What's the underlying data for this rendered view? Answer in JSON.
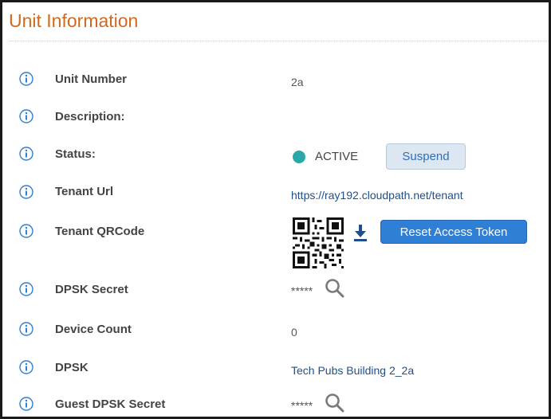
{
  "panel": {
    "title": "Unit Information"
  },
  "rows": {
    "unit_number": {
      "label": "Unit Number",
      "value": "2a"
    },
    "description": {
      "label": "Description:",
      "value": ""
    },
    "status": {
      "label": "Status:",
      "value": "ACTIVE",
      "dot_color": "#2aa8a8",
      "button": "Suspend"
    },
    "tenant_url": {
      "label": "Tenant Url",
      "value": "https://ray192.cloudpath.net/tenant"
    },
    "tenant_qrcode": {
      "label": "Tenant QRCode",
      "button": "Reset Access Token"
    },
    "dpsk_secret": {
      "label": "DPSK Secret",
      "value": "*****"
    },
    "device_count": {
      "label": "Device Count",
      "value": "0"
    },
    "dpsk": {
      "label": "DPSK",
      "value": "Tech Pubs Building 2_2a"
    },
    "guest_dpsk_secret": {
      "label": "Guest DPSK Secret",
      "value": "*****"
    }
  },
  "colors": {
    "title": "#d2691e",
    "info_icon": "#2f7fd6",
    "link": "#1f4f8b",
    "primary_button": "#2f7fd6"
  },
  "icons": {
    "info": "info-circle-icon",
    "search": "magnifier-icon",
    "download": "download-arrow-icon",
    "qr": "qr-code"
  }
}
